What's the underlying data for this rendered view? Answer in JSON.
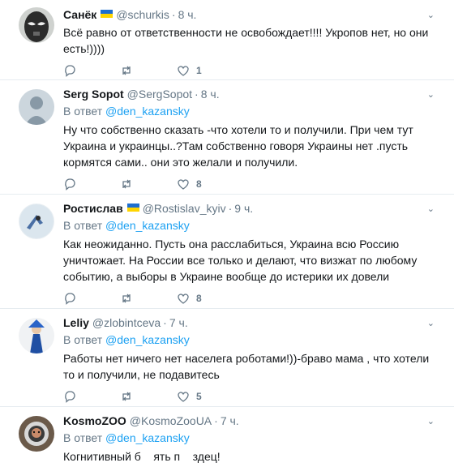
{
  "tweets": [
    {
      "name": "Санёк",
      "flag": true,
      "handle": "@schurkis",
      "time": "8 ч.",
      "reply_prefix": "",
      "reply_mention": "",
      "text": "Всё равно от ответственности не освобождает!!!! Укропов нет, но они есть!))))",
      "likes": "1",
      "avatar_icon": "mask-avatar-icon"
    },
    {
      "name": "Serg Sopot",
      "flag": false,
      "handle": "@SergSopot",
      "time": "8 ч.",
      "reply_prefix": "В ответ ",
      "reply_mention": "@den_kazansky",
      "text": "Ну что собственно сказать -что хотели то и получили. При чем тут Украина и украинцы..?Там собственно говоря Украины нет .пусть кормятся сами..  они это желали и получили.",
      "likes": "8",
      "avatar_icon": "default-avatar-icon"
    },
    {
      "name": "Ростислав",
      "flag": true,
      "handle": "@Rostislav_kyiv",
      "time": "9 ч.",
      "reply_prefix": "В ответ ",
      "reply_mention": "@den_kazansky",
      "text": "Как неожиданно. Пусть она расслабиться, Украина всю Россию уничтожает. На России все только и делают, что визжат по любому событию, а выборы в Украине вообще до истерики их довели",
      "likes": "8",
      "avatar_icon": "bird-avatar-icon"
    },
    {
      "name": "Leliy",
      "flag": false,
      "handle": "@zlobintceva",
      "time": "7 ч.",
      "reply_prefix": "В ответ ",
      "reply_mention": "@den_kazansky",
      "text": "Работы нет ничего нет населега роботами!))-браво мама , что хотели то и получили, не подавитесь",
      "likes": "5",
      "avatar_icon": "costume-avatar-icon"
    },
    {
      "name": "KosmoZOO",
      "flag": false,
      "handle": "@KosmoZooUA",
      "time": "7 ч.",
      "reply_prefix": "В ответ ",
      "reply_mention": "@den_kazansky",
      "text": "Когнитивный б    ять п    здец!",
      "likes": "",
      "avatar_icon": "astronaut-avatar-icon"
    }
  ],
  "colors": {
    "link": "#1da1f2",
    "muted": "#657786",
    "divider": "#e6ecf0"
  }
}
